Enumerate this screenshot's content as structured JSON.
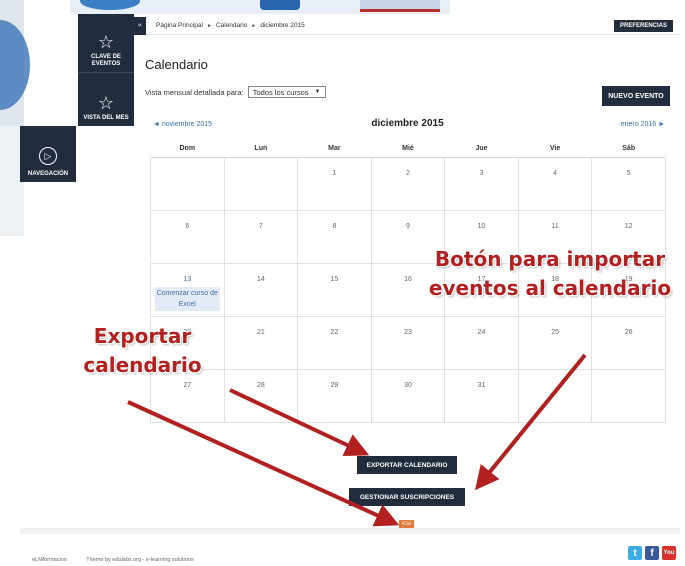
{
  "breadcrumb": {
    "collapse_label": "«",
    "items": [
      "Página Principal",
      "Calendario",
      "diciembre 2015"
    ],
    "separator": "►"
  },
  "header": {
    "preferences_label": "PREFERENCIAS"
  },
  "nav": {
    "block1": {
      "label": "CLAVE DE EVENTOS",
      "icon": "star-icon"
    },
    "block2": {
      "label": "VISTA DEL MES",
      "icon": "star-icon"
    },
    "block3": {
      "label": "NAVEGACIÓN",
      "icon": "compass-icon"
    }
  },
  "page": {
    "title": "Calendario",
    "filter_label": "Vista mensual detallada para:",
    "filter_value": "Todos los cursos",
    "new_event_label": "NUEVO EVENTO"
  },
  "calendar": {
    "prev_month": "◄ noviembre 2015",
    "current_month": "diciembre 2015",
    "next_month": "enero 2016 ►",
    "weekdays": [
      "Dom",
      "Lun",
      "Mar",
      "Mié",
      "Jue",
      "Vie",
      "Sáb"
    ],
    "weeks": [
      [
        "",
        "",
        "1",
        "2",
        "3",
        "4",
        "5"
      ],
      [
        "6",
        "7",
        "8",
        "9",
        "10",
        "11",
        "12"
      ],
      [
        "13",
        "14",
        "15",
        "16",
        "17",
        "18",
        "19"
      ],
      [
        "20",
        "21",
        "22",
        "23",
        "24",
        "25",
        "26"
      ],
      [
        "27",
        "28",
        "29",
        "30",
        "31",
        "",
        ""
      ]
    ],
    "event": {
      "day": "13",
      "title": "Comenzar curso de Excel"
    }
  },
  "actions": {
    "export_label": "EXPORTAR CALENDARIO",
    "subscriptions_label": "GESTIONAR SUSCRIPCIONES",
    "ical_label": "iCal"
  },
  "footer": {
    "left": "eLMformacion",
    "theme": "Theme by edulabs.org - e-learning solutions",
    "social": [
      "t",
      "f",
      "You"
    ]
  },
  "annotations": {
    "import_text": "Botón para importar eventos al calendario",
    "export_text": "Exportar calendario",
    "color": "#b22020"
  },
  "colors": {
    "dark_nav": "#212c3c",
    "link_blue": "#3a6fb0",
    "ical_orange": "#e07b3c"
  }
}
